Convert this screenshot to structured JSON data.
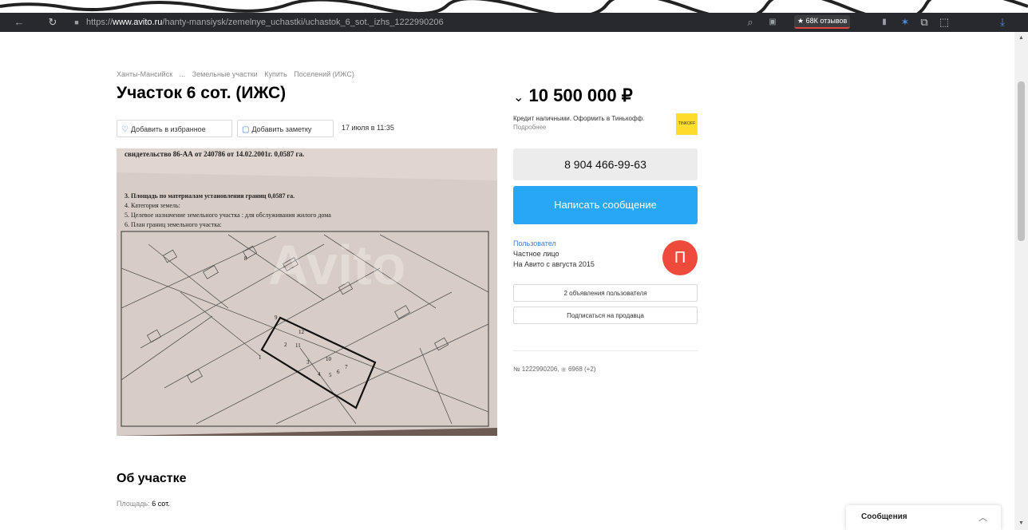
{
  "browser": {
    "url_prefix": "https://",
    "url_host": "www.avito.ru",
    "url_path": "/hanty-mansiysk/zemelnye_uchastki/uchastok_6_sot._izhs_1222990206",
    "reviews_badge": "★ 68К отзывов",
    "icons": [
      "back-icon",
      "reload-icon",
      "lock-icon",
      "search-icon",
      "translate-icon",
      "bookmark-icon",
      "star-icon",
      "screenshot-icon",
      "extensions-icon",
      "download-icon"
    ]
  },
  "breadcrumb": [
    "Ханты-Мансийск",
    "...",
    "Земельные участки",
    "Купить",
    "Поселений (ИЖС)"
  ],
  "listing": {
    "title": "Участок 6 сот. (ИЖС)",
    "add_favorite": "Добавить в избранное",
    "add_note": "Добавить заметку",
    "date": "17 июля в 11:35"
  },
  "price": {
    "value": "10 500 000 ₽",
    "credit_text": "Кредит наличными. Оформить в Тинькофф.",
    "credit_more": "Подробнее",
    "tink_logo": "TINKOFF"
  },
  "contact": {
    "phone": "8 904 466-99-63",
    "write_message": "Написать сообщение"
  },
  "seller": {
    "name": "Пользовател",
    "type": "Частное лицо",
    "since": "На Авито с августа 2015",
    "avatar_letter": "П",
    "listings_btn": "2 объявления пользователя",
    "subscribe_btn": "Подписаться на продавца"
  },
  "stats": {
    "id": "№ 1222990206,",
    "views": "6968 (+2)"
  },
  "about": {
    "heading": "Об участке",
    "area_label": "Площадь:",
    "area_value": "6 сот."
  },
  "photo_text": {
    "line0": "свидетельство 86-АА от 240786 от 14.02.2001г. 0,0587 га.",
    "line1": "3. Площадь по материалам установления границ 0,0587 га.",
    "line2": "4. Категория земель:",
    "line3": "5. Целевое назначение земельного участка : для обслуживания жилого дома",
    "line4": "6. План границ земельного участка:",
    "watermark": "Avito",
    "plot_numbers": [
      "12",
      "11",
      "10",
      "1",
      "2",
      "3",
      "4",
      "5",
      "6",
      "7",
      "8",
      "9"
    ]
  },
  "messages_widget": {
    "label": "Сообщения"
  },
  "colors": {
    "accent": "#27a7f5",
    "avatar": "#ef4b3c",
    "tinkoff": "#ffdd2d",
    "link": "#3d7dd6"
  }
}
